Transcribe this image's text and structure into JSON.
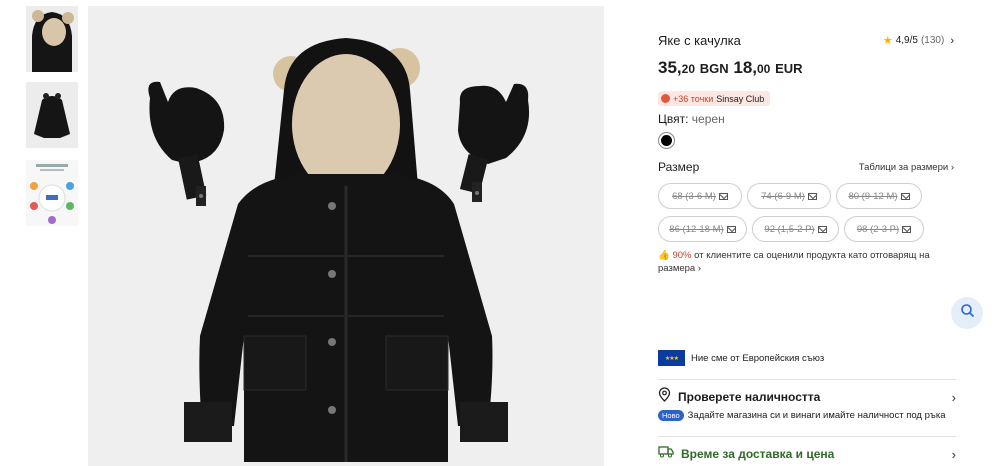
{
  "product": {
    "title": "Яке с качулка",
    "rating": {
      "score": "4,9/5",
      "count": "(130)"
    },
    "price": {
      "bgn_main": "35,",
      "bgn_cents": "20",
      "bgn_currency": "BGN",
      "eur_main": "18,",
      "eur_cents": "00",
      "eur_currency": "EUR"
    },
    "points": {
      "amount": "+36 точки",
      "club": "Sinsay Club"
    },
    "color": {
      "label": "Цвят:",
      "value": "черен",
      "swatch_color": "#000000"
    },
    "size": {
      "label": "Размер",
      "tables_link": "Таблици за размери",
      "options": [
        {
          "label": "68 (3-6 M)",
          "available": false
        },
        {
          "label": "74 (6-9 M)",
          "available": false
        },
        {
          "label": "80 (9-12 M)",
          "available": false
        },
        {
          "label": "86 (12-18 M)",
          "available": false
        },
        {
          "label": "92 (1,5-2 Р)",
          "available": false
        },
        {
          "label": "98 (2-3 Р)",
          "available": false
        }
      ]
    },
    "fit_note": {
      "percent": "90%",
      "text": "от клиентите са оценили продукта като отговарящ на размера"
    }
  },
  "info": {
    "eu_text": "Ние сме от Европейския съюз",
    "availability_title": "Проверете наличността",
    "new_badge": "Ново",
    "availability_text": "Задайте магазина си и винаги имайте наличност под ръка",
    "delivery_title": "Време за доставка и цена"
  },
  "colors": {
    "accent_red": "#c9402a",
    "accent_green": "#2f6b27",
    "accent_blue": "#2c62c9"
  }
}
